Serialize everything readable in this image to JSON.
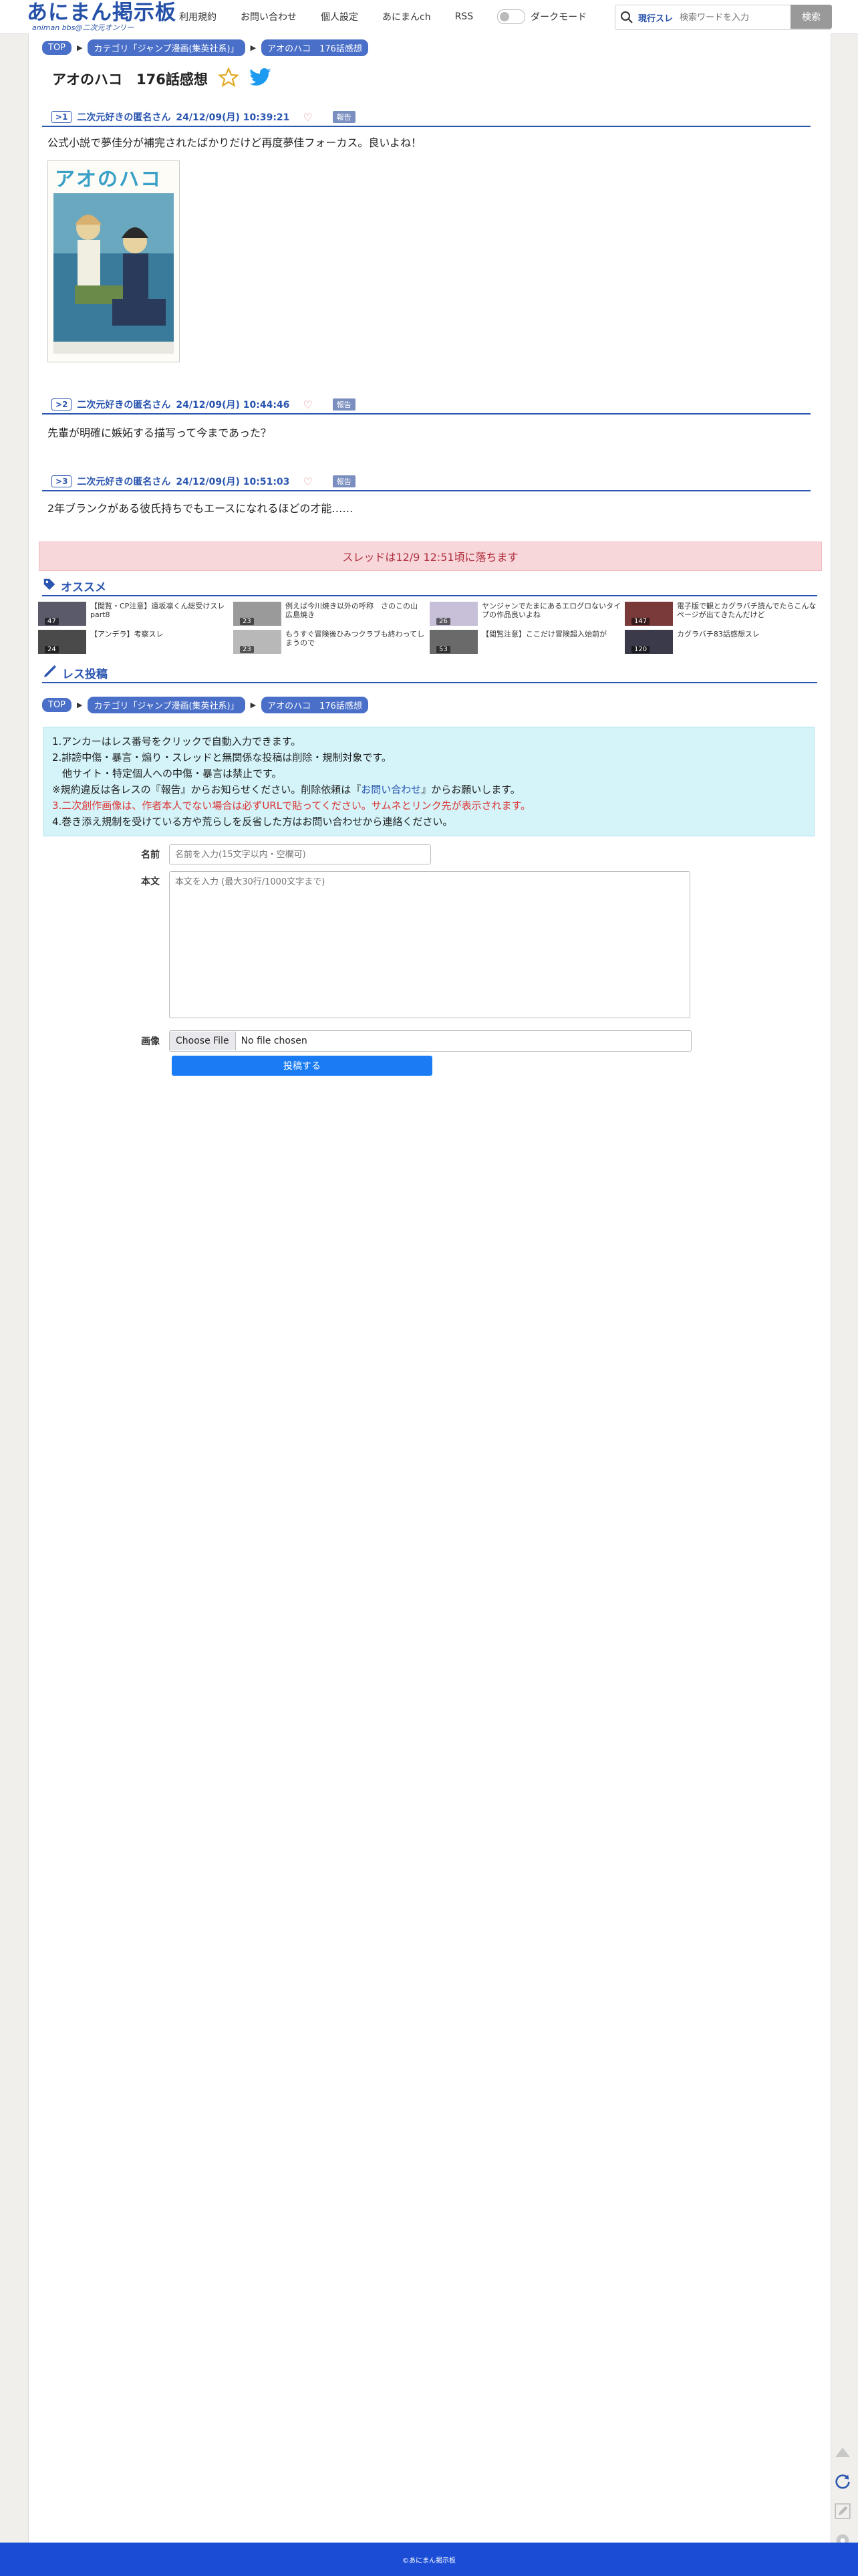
{
  "site": {
    "logo_main": "あにまん掲示板",
    "logo_sub": "animan bbs@二次元オンリー"
  },
  "nav": {
    "items": [
      "利用規約",
      "お問い合わせ",
      "個人設定",
      "あにまんch",
      "RSS"
    ],
    "dark_mode_label": "ダークモード"
  },
  "search": {
    "scope": "現行スレ",
    "placeholder": "検索ワードを入力",
    "button": "検索"
  },
  "breadcrumb": [
    "TOP",
    "カテゴリ「ジャンプ漫画(集英社系)」",
    "アオのハコ　176話感想"
  ],
  "thread": {
    "title": "アオのハコ　176話感想"
  },
  "posts": [
    {
      "no": "1",
      "name": "二次元好きの匿名さん",
      "date": "24/12/09(月) 10:39:21",
      "report": "報告",
      "body": "公式小説で夢佳分が補完されたばかりだけど再度夢佳フォーカス。良いよね！",
      "image_title": "アオのハコ"
    },
    {
      "no": "2",
      "name": "二次元好きの匿名さん",
      "date": "24/12/09(月) 10:44:46",
      "report": "報告",
      "body": "先輩が明確に嫉妬する描写って今まであった？"
    },
    {
      "no": "3",
      "name": "二次元好きの匿名さん",
      "date": "24/12/09(月) 10:51:03",
      "report": "報告",
      "body": "2年ブランクがある彼氏持ちでもエースになれるほどの才能……"
    }
  ],
  "fall_notice": "スレッドは12/9 12:51頃に落ちます",
  "recommend": {
    "title": "オススメ",
    "items": [
      {
        "text": "【閲覧・CP注意】遠坂凛くん総受けスレpart8",
        "count": "47"
      },
      {
        "text": "例えば今川焼き以外の呼称　さのこの山　広島焼き",
        "count": "23"
      },
      {
        "text": "ヤンジャンでたまにあるエログロないタイプの作品良いよね",
        "count": "26"
      },
      {
        "text": "電子版で観とカグラバチ読んでたらこんなページが出てきたんだけど",
        "count": "147"
      },
      {
        "text": "【アンデラ】考察スレ",
        "count": "24"
      },
      {
        "text": "もうすぐ冒険後ひみつクラブも終わってしまうので",
        "count": "23"
      },
      {
        "text": "【閲覧注意】ここだけ冒険超入始前が",
        "count": "53"
      },
      {
        "text": "カグラバチ83話感想スレ",
        "count": "120"
      }
    ]
  },
  "reply": {
    "title": "レス投稿",
    "rules": [
      "1.アンカーはレス番号をクリックで自動入力できます。",
      "2.誹謗中傷・暴言・煽り・スレッドと無関係な投稿は削除・規制対象です。",
      "　他サイト・特定個人への中傷・暴言は禁止です。",
      "※規約違反は各レスの『報告』からお知らせください。削除依頼は『",
      "お問い合わせ",
      "』からお願いします。",
      "3.二次創作画像は、作者本人でない場合は必ずURLで貼ってください。サムネとリンク先が表示されます。",
      "4.巻き添え規制を受けている方や荒らしを反省した方はお問い合わせから連絡ください。"
    ],
    "name_label": "名前",
    "name_placeholder": "名前を入力(15文字以内・空欄可)",
    "body_label": "本文",
    "body_placeholder": "本文を入力 (最大30行/1000文字まで)",
    "image_label": "画像",
    "file_choose": "Choose File",
    "file_none": "No file chosen",
    "submit": "投稿する"
  },
  "footer": "©あにまん掲示板",
  "colors": {
    "brand": "#2a55b0",
    "footer": "#1a4cd6",
    "submit": "#1a7cf5",
    "notice_bg": "#f8d7da",
    "rules_bg": "#d4f4f9"
  }
}
